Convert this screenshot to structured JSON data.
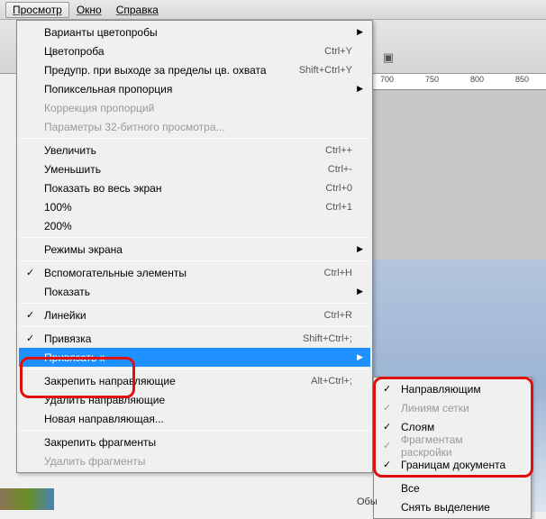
{
  "menubar": {
    "view": "Просмотр",
    "window": "Окно",
    "help": "Справка"
  },
  "menu": {
    "proofSetup": "Варианты цветопробы",
    "proofColors": "Цветопроба",
    "proofColors_sc": "Ctrl+Y",
    "gamutWarning": "Предупр. при выходе за пределы цв. охвата",
    "gamutWarning_sc": "Shift+Ctrl+Y",
    "pixelAspect": "Попиксельная пропорция",
    "aspectCorrection": "Коррекция пропорций",
    "bit32": "Параметры 32-битного просмотра...",
    "zoomIn": "Увеличить",
    "zoomIn_sc": "Ctrl++",
    "zoomOut": "Уменьшить",
    "zoomOut_sc": "Ctrl+-",
    "fitScreen": "Показать во весь экран",
    "fitScreen_sc": "Ctrl+0",
    "actual": "100%",
    "actual_sc": "Ctrl+1",
    "z200": "200%",
    "screenMode": "Режимы экрана",
    "extras": "Вспомогательные элементы",
    "extras_sc": "Ctrl+H",
    "show": "Показать",
    "rulers": "Линейки",
    "rulers_sc": "Ctrl+R",
    "snap": "Привязка",
    "snap_sc": "Shift+Ctrl+;",
    "snapTo": "Привязать к",
    "lockGuides": "Закрепить направляющие",
    "lockGuides_sc": "Alt+Ctrl+;",
    "clearGuides": "Удалить направляющие",
    "newGuide": "Новая направляющая...",
    "lockSlices": "Закрепить фрагменты",
    "clearSlices": "Удалить фрагменты"
  },
  "submenu": {
    "guides": "Направляющим",
    "grid": "Линиям сетки",
    "layers": "Слоям",
    "slices": "Фрагментам раскройки",
    "docBounds": "Границам документа",
    "all": "Все",
    "none": "Снять выделение"
  },
  "ruler": {
    "t700": "700",
    "t750": "750",
    "t800": "800",
    "t850": "850"
  },
  "tab": "Обы"
}
